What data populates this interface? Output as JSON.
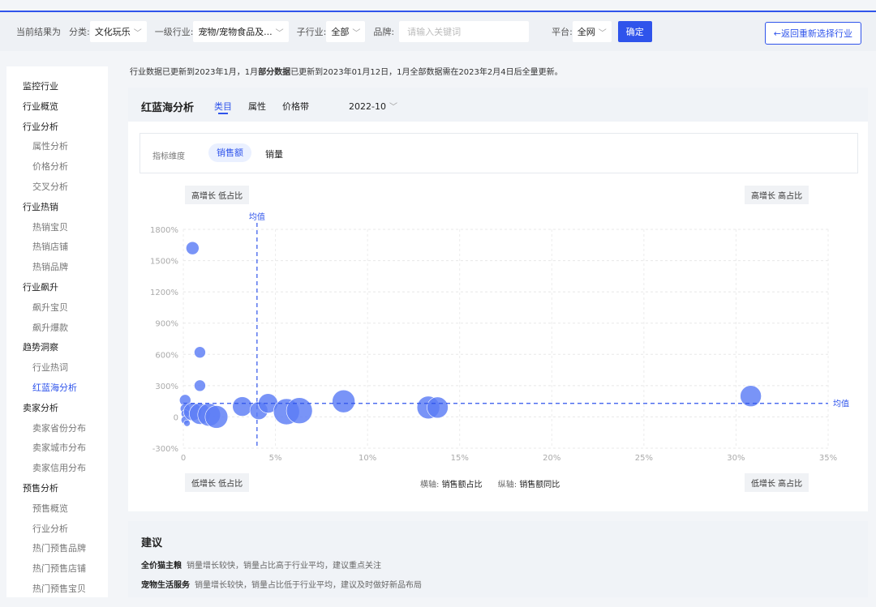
{
  "filters": {
    "current_label": "当前结果为",
    "category_label": "分类:",
    "category_value": "文化玩乐",
    "industry_label": "一级行业:",
    "industry_value": "宠物/宠物食品及...",
    "sub_label": "子行业:",
    "sub_value": "全部",
    "brand_label": "品牌:",
    "brand_placeholder": "请输入关键词",
    "platform_label": "平台:",
    "platform_value": "全网",
    "confirm": "确定",
    "back": "←返回重新选择行业"
  },
  "sidebar": {
    "items": [
      {
        "label": "监控行业",
        "level": 1
      },
      {
        "label": "行业概览",
        "level": 1
      },
      {
        "label": "行业分析",
        "level": 1
      },
      {
        "label": "属性分析",
        "level": 2
      },
      {
        "label": "价格分析",
        "level": 2
      },
      {
        "label": "交叉分析",
        "level": 2
      },
      {
        "label": "行业热销",
        "level": 1
      },
      {
        "label": "热销宝贝",
        "level": 2
      },
      {
        "label": "热销店铺",
        "level": 2
      },
      {
        "label": "热销品牌",
        "level": 2
      },
      {
        "label": "行业飙升",
        "level": 1
      },
      {
        "label": "飙升宝贝",
        "level": 2
      },
      {
        "label": "飙升爆款",
        "level": 2
      },
      {
        "label": "趋势洞察",
        "level": 1
      },
      {
        "label": "行业热词",
        "level": 2
      },
      {
        "label": "红蓝海分析",
        "level": 2,
        "active": true
      },
      {
        "label": "卖家分析",
        "level": 1
      },
      {
        "label": "卖家省份分布",
        "level": 2
      },
      {
        "label": "卖家城市分布",
        "level": 2
      },
      {
        "label": "卖家信用分布",
        "level": 2
      },
      {
        "label": "预售分析",
        "level": 1
      },
      {
        "label": "预售概览",
        "level": 2
      },
      {
        "label": "行业分析",
        "level": 2
      },
      {
        "label": "热门预售品牌",
        "level": 2
      },
      {
        "label": "热门预售店铺",
        "level": 2
      },
      {
        "label": "热门预售宝贝",
        "level": 2
      }
    ]
  },
  "notice": {
    "p1": "行业数据已更新到2023年1月，1月",
    "b1": "部分数据",
    "p2": "已更新到2023年01月12日，1月全部数据需在2023年2月4日后全量更新。"
  },
  "panel": {
    "title": "红蓝海分析",
    "tabs": [
      "类目",
      "属性",
      "价格带"
    ],
    "date": "2022-10",
    "metric_label": "指标维度",
    "metric_selected": "销售额",
    "metric_other": "销量"
  },
  "quadrants": {
    "top_left": "高增长 低占比",
    "top_right": "高增长 高占比",
    "bottom_left": "低增长 低占比",
    "bottom_right": "低增长 高占比"
  },
  "axis_caption": {
    "x_prefix": "横轴:",
    "x_value": "销售额占比",
    "y_prefix": "纵轴:",
    "y_value": "销售额同比"
  },
  "chart_data": {
    "type": "scatter",
    "xlabel": "销售额占比",
    "ylabel": "销售额同比",
    "x_ticks": [
      "0",
      "5%",
      "10%",
      "15%",
      "20%",
      "25%",
      "30%",
      "35%"
    ],
    "y_ticks": [
      "1800%",
      "1500%",
      "1200%",
      "900%",
      "600%",
      "300%",
      "0",
      "-300%"
    ],
    "xlim": [
      0,
      35
    ],
    "ylim": [
      -300,
      1800
    ],
    "mean_label": "均值",
    "mean_x": 4.0,
    "mean_y": 130,
    "bubble_color": "#5b7cf5",
    "points": [
      {
        "x": 0.5,
        "y": 1620,
        "r": 8
      },
      {
        "x": 0.9,
        "y": 620,
        "r": 7
      },
      {
        "x": 0.9,
        "y": 300,
        "r": 7
      },
      {
        "x": 0.1,
        "y": 160,
        "r": 7
      },
      {
        "x": 0.1,
        "y": 80,
        "r": 6
      },
      {
        "x": 0.1,
        "y": 30,
        "r": 5
      },
      {
        "x": 0.1,
        "y": -30,
        "r": 5
      },
      {
        "x": 0.2,
        "y": -60,
        "r": 4
      },
      {
        "x": 0.5,
        "y": 50,
        "r": 11
      },
      {
        "x": 0.9,
        "y": 30,
        "r": 13
      },
      {
        "x": 1.4,
        "y": 20,
        "r": 14
      },
      {
        "x": 1.8,
        "y": 0,
        "r": 14
      },
      {
        "x": 3.2,
        "y": 100,
        "r": 12
      },
      {
        "x": 4.1,
        "y": 60,
        "r": 11
      },
      {
        "x": 4.6,
        "y": 130,
        "r": 12
      },
      {
        "x": 5.6,
        "y": 50,
        "r": 16
      },
      {
        "x": 6.3,
        "y": 60,
        "r": 16
      },
      {
        "x": 8.7,
        "y": 150,
        "r": 14
      },
      {
        "x": 13.3,
        "y": 90,
        "r": 14
      },
      {
        "x": 13.8,
        "y": 90,
        "r": 13
      },
      {
        "x": 30.8,
        "y": 200,
        "r": 13
      }
    ]
  },
  "advice": {
    "title": "建议",
    "rows": [
      {
        "name": "全价猫主粮",
        "text": "销量增长较快，销量占比高于行业平均，建议重点关注"
      },
      {
        "name": "宠物生活服务",
        "text": "销量增长较快，销量占比低于行业平均，建议及时做好新品布局"
      }
    ]
  }
}
